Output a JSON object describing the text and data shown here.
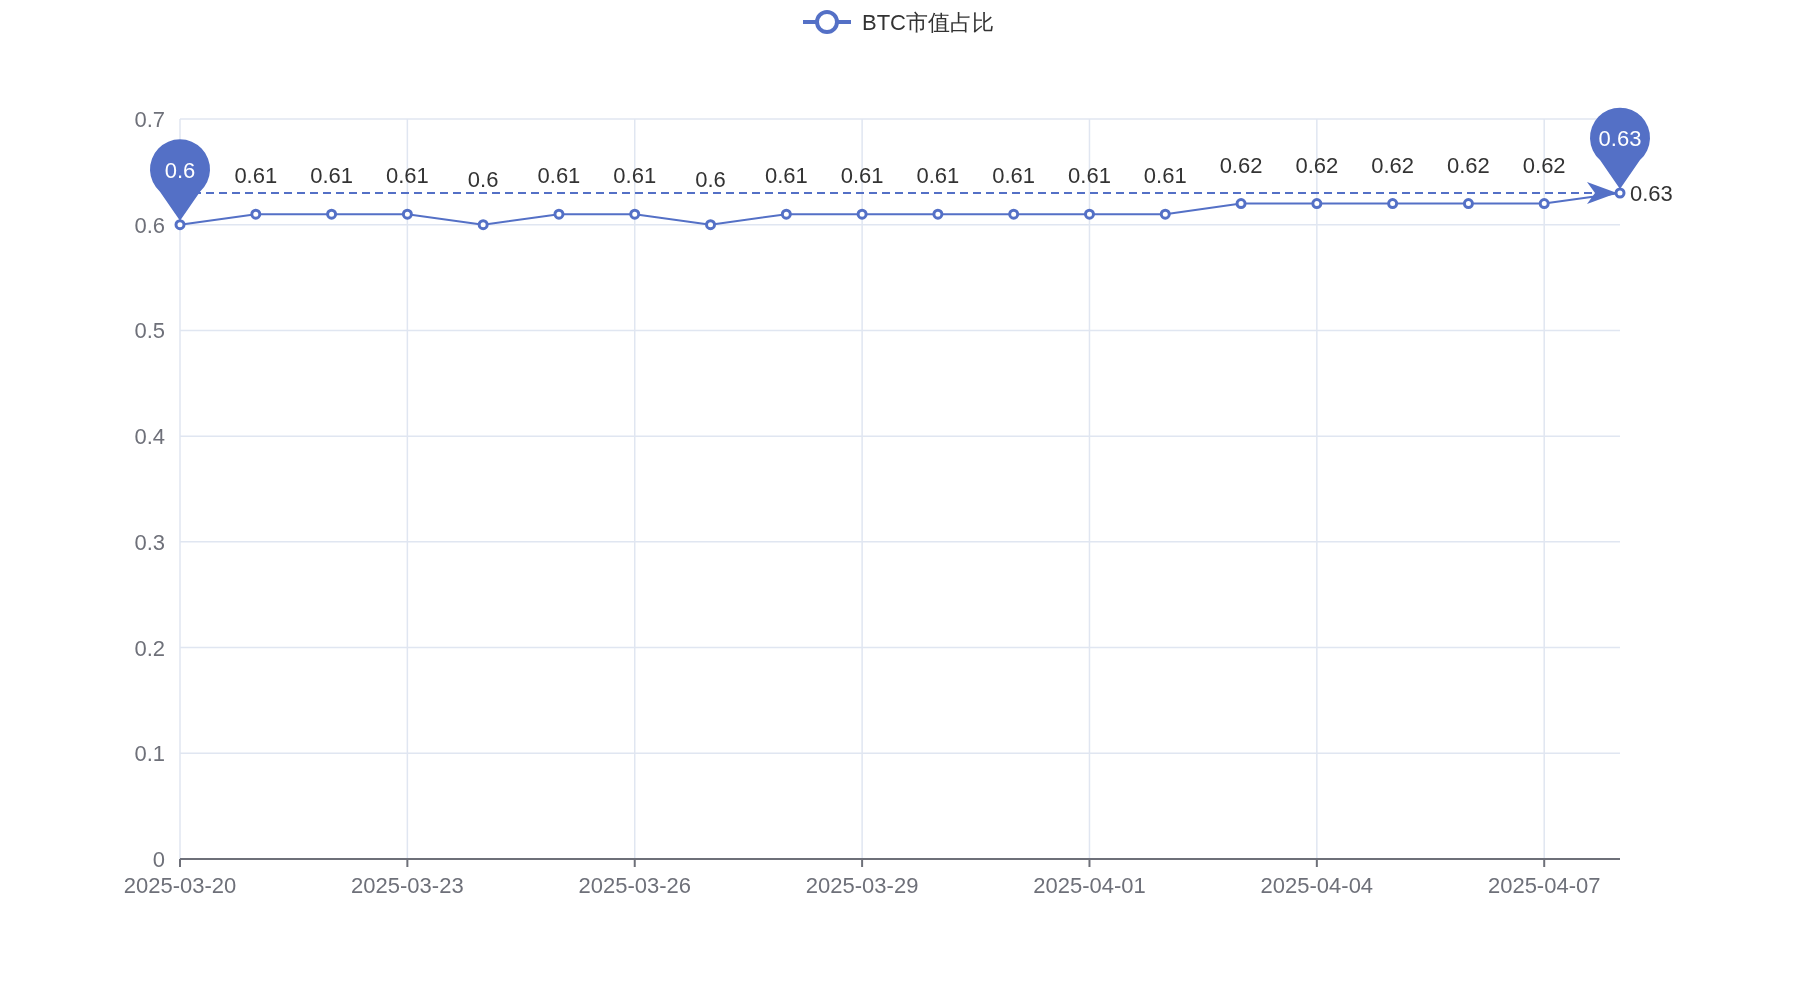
{
  "chart_data": {
    "type": "line",
    "categories": [
      "2025-03-20",
      null,
      null,
      "2025-03-23",
      null,
      null,
      "2025-03-26",
      null,
      null,
      "2025-03-29",
      null,
      null,
      "2025-04-01",
      null,
      null,
      "2025-04-04",
      null,
      null,
      "2025-04-07",
      null
    ],
    "series": [
      {
        "name": "BTC市值占比",
        "color": "#5470c6",
        "marker": "circle",
        "values": [
          0.6,
          0.61,
          0.61,
          0.61,
          0.6,
          0.61,
          0.61,
          0.6,
          0.61,
          0.61,
          0.61,
          0.61,
          0.61,
          0.61,
          0.62,
          0.62,
          0.62,
          0.62,
          0.62,
          0.63
        ]
      }
    ],
    "ylim": [
      0,
      0.7
    ],
    "yticks": [
      0,
      0.1,
      0.2,
      0.3,
      0.4,
      0.5,
      0.6,
      0.7
    ],
    "grid": true,
    "value_labels": [
      null,
      "0.61",
      "0.61",
      "0.61",
      "0.6",
      "0.61",
      "0.61",
      "0.6",
      "0.61",
      "0.61",
      "0.61",
      "0.61",
      "0.61",
      "0.61",
      "0.62",
      "0.62",
      "0.62",
      "0.62",
      "0.62",
      null
    ],
    "annotations": [
      {
        "text": "0.6",
        "y": 0.6
      },
      {
        "text": "0.63",
        "y": 0.63
      }
    ],
    "ref_lines": [
      {
        "axis": "y",
        "value": 0.63,
        "label": "0.63"
      }
    ]
  }
}
